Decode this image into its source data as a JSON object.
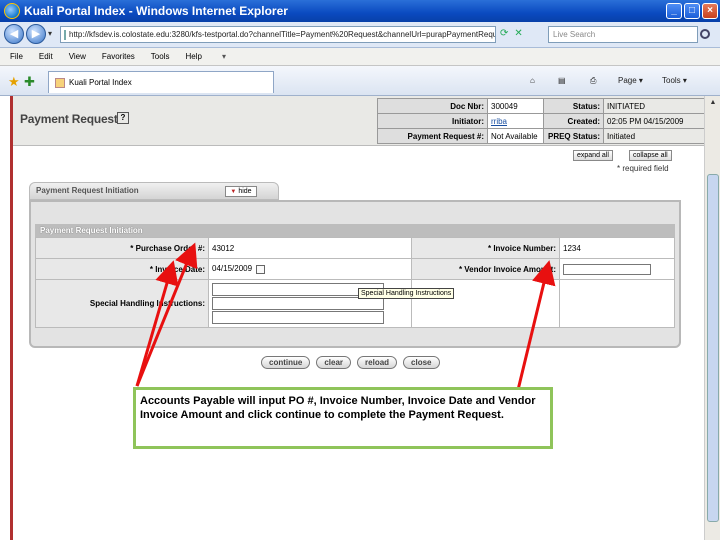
{
  "window": {
    "title": "Kuali Portal Index - Windows Internet Explorer",
    "min": "_",
    "max": "□",
    "close": "×"
  },
  "address": {
    "url": "http://kfsdev.is.colostate.edu:3280/kfs-testportal.do?channelTitle=Payment%20Request&channelUrl=purapPaymentRequ",
    "search_placeholder": "Live Search",
    "back": "◀",
    "forward": "▶",
    "nav_dropdown": "▾"
  },
  "menu": [
    "File",
    "Edit",
    "View",
    "Favorites",
    "Tools",
    "Help"
  ],
  "menu_extra": "▾",
  "tabbar": {
    "tab_label": "Kuali Portal Index",
    "commands": [
      "Page ▾",
      "Tools ▾"
    ],
    "home": "⌂",
    "feeds": "▤",
    "print": "⎙"
  },
  "document": {
    "title": "Payment Request",
    "help": "?",
    "info": [
      {
        "label": "Doc Nbr:",
        "value": "300049",
        "label2": "Status:",
        "value2": "INITIATED"
      },
      {
        "label": "Initiator:",
        "value": "rriba",
        "label2": "Created:",
        "value2": "02:05 PM 04/15/2009"
      },
      {
        "label": "Payment Request #:",
        "value": "Not Available",
        "label2": "PREQ Status:",
        "value2": "Initiated"
      }
    ],
    "expand_all": "expand all",
    "collapse_all": "collapse all",
    "required_note": "* required field"
  },
  "panel": {
    "tab_title": "Payment Request Initiation",
    "hide_label": "hide",
    "section_title": "Payment Request Initiation",
    "fields": {
      "po_label": "* Purchase Order #:",
      "po_value": "43012",
      "invoice_number_label": "* Invoice Number:",
      "invoice_number_value": "1234",
      "invoice_date_label": "* Invoice Date:",
      "invoice_date_value": "04/15/2009",
      "vendor_amount_label": "* Vendor Invoice Amount:",
      "vendor_amount_value": "",
      "special_label": "Special Handling Instructions:"
    },
    "tooltip": "Special Handling Instructions"
  },
  "buttons": {
    "continue": "continue",
    "clear": "clear",
    "reload": "reload",
    "close": "close"
  },
  "callout": {
    "text": "Accounts Payable will input PO #, Invoice Number, Invoice Date and Vendor Invoice Amount and click continue to complete the Payment Request."
  },
  "colors": {
    "arrow": "#e81010",
    "callout_border": "#8fc45a",
    "page_border": "#b03030"
  }
}
